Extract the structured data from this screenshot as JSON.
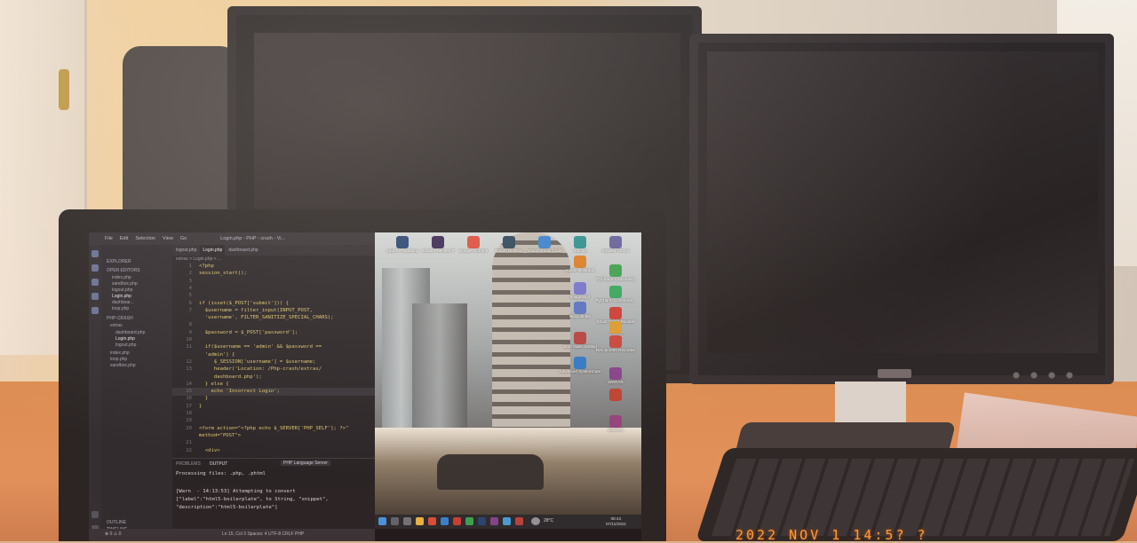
{
  "vscode": {
    "menu": [
      "File",
      "Edit",
      "Selection",
      "View",
      "Go"
    ],
    "window_title": "Login.php - PHP - crush - Vi...",
    "tabs": [
      "logout.php",
      "Login.php",
      "dashboard.php"
    ],
    "breadcrumb": "extras > Login.php > ...",
    "sidebar": {
      "header": "EXPLORER",
      "open_editors": "OPEN EDITORS",
      "open_files": [
        "index.php",
        "sandbox.php",
        "logout.php",
        "Login.php",
        "dashboar...",
        "loop.php"
      ],
      "project": "PHP-CRASH",
      "folder": "extras",
      "project_files": [
        "dashboard.php",
        "Login.php",
        "logout.php",
        "index.php",
        "loop.php",
        "sandbox.php"
      ],
      "footer": [
        "OUTLINE",
        "TIMELINE"
      ]
    },
    "code_lines": [
      {
        "n": "1",
        "text": "<?php"
      },
      {
        "n": "2",
        "text": "session_start();"
      },
      {
        "n": "3",
        "text": ""
      },
      {
        "n": "4",
        "text": ""
      },
      {
        "n": "5",
        "text": ""
      },
      {
        "n": "6",
        "text": "if (isset($_POST['submit'])) {"
      },
      {
        "n": "7",
        "text": "  $username = filter_input(INPUT_POST,"
      },
      {
        "n": "",
        "text": "  'username', FILTER_SANITIZE_SPECIAL_CHARS);"
      },
      {
        "n": "8",
        "text": ""
      },
      {
        "n": "9",
        "text": "  $password = $_POST['password'];"
      },
      {
        "n": "10",
        "text": ""
      },
      {
        "n": "11",
        "text": "  if($username == 'admin' && $password =="
      },
      {
        "n": "",
        "text": "  'admin') {"
      },
      {
        "n": "12",
        "text": "     $_SESSION['username'] = $username;"
      },
      {
        "n": "13",
        "text": "     header('Location: /Php-crash/extras/"
      },
      {
        "n": "",
        "text": "     dashboard.php');"
      },
      {
        "n": "14",
        "text": "  } else {"
      },
      {
        "n": "15",
        "text": "    echo 'Incorrect Login';"
      },
      {
        "n": "16",
        "text": "  }"
      },
      {
        "n": "17",
        "text": "}"
      },
      {
        "n": "18",
        "text": ""
      },
      {
        "n": "19",
        "text": ""
      },
      {
        "n": "20",
        "text": "<form action=\"<?php echo $_SERVER['PHP_SELF']; ?>\""
      },
      {
        "n": "",
        "text": "method=\"POST\">"
      },
      {
        "n": "21",
        "text": ""
      },
      {
        "n": "22",
        "text": "  <div>"
      }
    ],
    "panel": {
      "tabs": [
        "PROBLEMS",
        "OUTPUT"
      ],
      "badge": "PHP Language Server",
      "lines": [
        "Processing files: .php, .phtml",
        "",
        "[Warn  - 14:13:53] Attempting to convert",
        "[\"label\":\"html5-boilerplate\", to String, \"snippet\",",
        "\"description\":\"html5-boilerplate\"]"
      ]
    },
    "status": {
      "left": "⊗ 0 ⚠ 0",
      "right": "Ln 15, Col 3   Spaces: 4   UTF-8   CRLF   PHP"
    }
  },
  "desktop": {
    "icons": [
      {
        "label": "Adobe Photoshop",
        "color": "#1b3b6f"
      },
      {
        "label": "Adobe Premiere P",
        "color": "#2a1b4f"
      },
      {
        "label": "Google Chrome",
        "color": "#d94435"
      },
      {
        "label": "Steam Desktop",
        "color": "#1c3b55"
      },
      {
        "label": "Visual Studio Code",
        "color": "#2b7bd1"
      },
      {
        "label": "Arduino",
        "color": "#1e8c8c"
      },
      {
        "label": "AIDA64 CPU-Z",
        "color": "#5a5a9a"
      },
      {
        "label": "PyCharm Community",
        "color": "#2f9e4a"
      },
      {
        "label": "Adobe Illustrator",
        "color": "#d7771b"
      },
      {
        "label": "PyCharm Communit...",
        "color": "#27a35a"
      },
      {
        "label": "Imagining3",
        "color": "#6d6dcf"
      },
      {
        "label": "Smart Game Booster",
        "color": "#c8342f"
      },
      {
        "label": "Recycle Bin",
        "color": "#4c6cc4"
      },
      {
        "label": "Scratch",
        "color": "#d9982a"
      },
      {
        "label": "Start Video Editing",
        "color": "#b13a3a"
      },
      {
        "label": "Rec Screen Recorder",
        "color": "#c33d35"
      },
      {
        "label": "Advanced SystemCare",
        "color": "#2273c9"
      },
      {
        "label": "WinRAR",
        "color": "#7d3a8a"
      },
      {
        "label": "",
        "color": "#b9392d"
      },
      {
        "label": "WinRAR",
        "color": "#8c3b7a"
      }
    ],
    "taskbar": {
      "temperature": "28°C",
      "time": "08:43",
      "date": "07/11/2022"
    }
  },
  "camera": {
    "timestamp": "2022 NOV 1 14:5? ?"
  }
}
